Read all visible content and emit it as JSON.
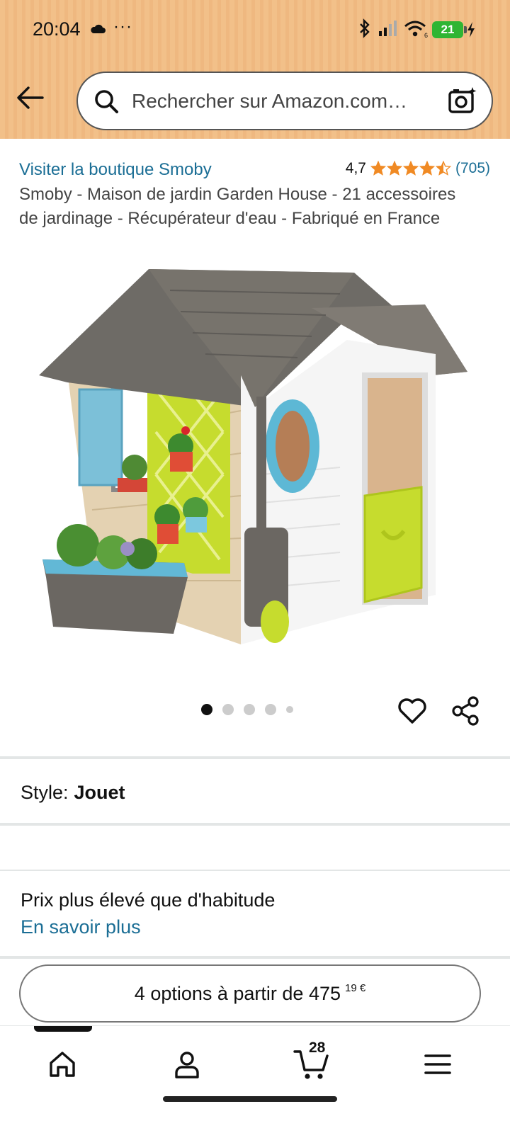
{
  "status_bar": {
    "time": "20:04",
    "battery": "21",
    "icons": [
      "cloud-icon",
      "more-dots-icon",
      "bluetooth-icon",
      "signal-icon",
      "wifi-icon",
      "battery-icon",
      "charging-icon"
    ]
  },
  "search": {
    "placeholder": "Rechercher sur Amazon.com…"
  },
  "product": {
    "store_link": "Visiter la boutique Smoby",
    "rating_value": "4,7",
    "rating_stars": 4.5,
    "rating_count": "(705)",
    "title": "Smoby - Maison de jardin Garden House - 21 accessoires de jardinage - Récupérateur d'eau - Fabriqué en France",
    "image_count": 5,
    "active_image": 1
  },
  "style": {
    "label": "Style:",
    "value": "Jouet"
  },
  "price_info": {
    "note": "Prix plus élevé que d'habitude",
    "link": "En savoir plus"
  },
  "options_button": {
    "text": "4 options à partir de 475",
    "cents": "19",
    "currency": "€"
  },
  "bottom_nav": {
    "cart_count": "28",
    "items": [
      "home-icon",
      "account-icon",
      "cart-icon",
      "menu-icon"
    ]
  },
  "colors": {
    "header_bg": "#f2c089",
    "link": "#1b6e95",
    "star": "#f08a24"
  }
}
